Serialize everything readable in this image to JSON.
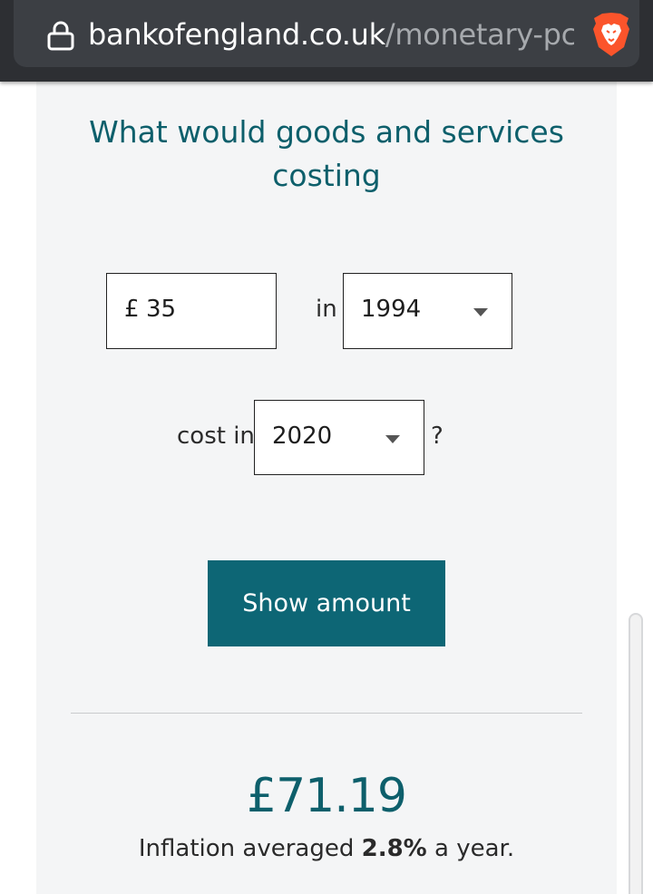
{
  "browser": {
    "url_domain": "bankofengland.co.uk",
    "url_path": "/monetary-pc",
    "accent": "#fb542b"
  },
  "calculator": {
    "heading": "What would goods and services costing",
    "currency_symbol": "£",
    "amount_value": "35",
    "in_label": "in",
    "from_year": "1994",
    "cost_in_label": "cost in",
    "to_year": "2020",
    "question_mark": "?",
    "submit_label": "Show amount"
  },
  "result": {
    "amount": "£71.19",
    "summary_prefix": "Inflation averaged",
    "rate": "2.8%",
    "summary_suffix": "a year."
  },
  "colors": {
    "brand_teal": "#0d6675",
    "heading_teal": "#0d5f6b"
  }
}
